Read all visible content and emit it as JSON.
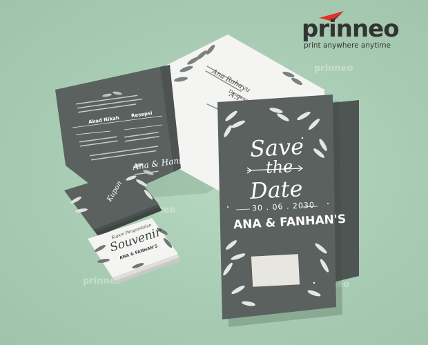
{
  "brand": {
    "name": "prinneo",
    "tagline": "print anywhere anytime",
    "accent_color": "#e0332c",
    "text_color": "#333333"
  },
  "watermarks": [
    "prinneo",
    "prinneo",
    "prinneo",
    "prinneo",
    "prinneo"
  ],
  "front_card": {
    "line1": "Save",
    "line2": "the",
    "line3": "Date",
    "date": "30 . 06 . 2030",
    "names": "ANA & FANHAN'S",
    "color": "#5a615f"
  },
  "open_card": {
    "left_title": "Akad Nikah",
    "right_title": "Resepsi",
    "couple": "Ana & Hans",
    "bride_name": "Ana Rahayu",
    "with": "Dengan",
    "groom_initials": "A.T. & Ds"
  },
  "business_cards": {
    "top_title": "Kupon",
    "souvenir_header": "Kupon Pengambilan",
    "souvenir_title": "Souvenir",
    "souvenir_names": "ANA & FANHAN'S"
  },
  "colors": {
    "background": "#a9cdb4",
    "card_dark": "#5a615f",
    "card_light": "#f4f4f2"
  }
}
